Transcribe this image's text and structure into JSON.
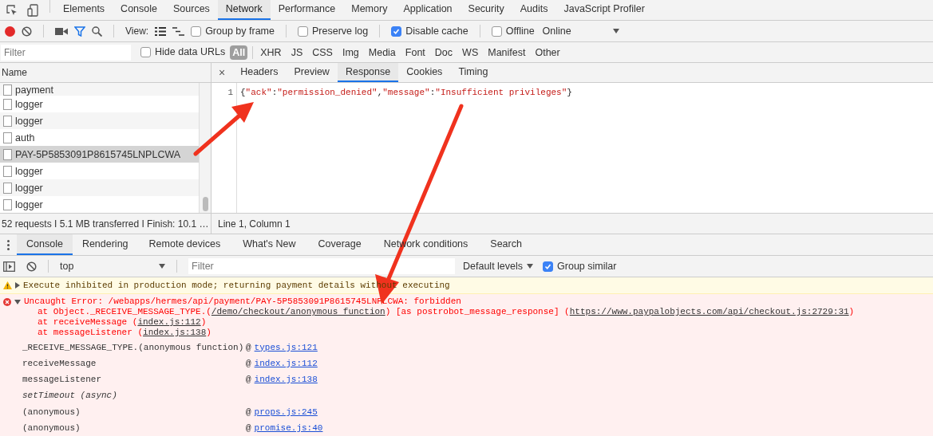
{
  "main_tabs": [
    {
      "label": "Elements",
      "selected": false
    },
    {
      "label": "Console",
      "selected": false
    },
    {
      "label": "Sources",
      "selected": false
    },
    {
      "label": "Network",
      "selected": true
    },
    {
      "label": "Performance",
      "selected": false
    },
    {
      "label": "Memory",
      "selected": false
    },
    {
      "label": "Application",
      "selected": false
    },
    {
      "label": "Security",
      "selected": false
    },
    {
      "label": "Audits",
      "selected": false
    },
    {
      "label": "JavaScript Profiler",
      "selected": false
    }
  ],
  "network_toolbar": {
    "recording": true,
    "view_label": "View:",
    "checkboxes": [
      {
        "label": "Group by frame",
        "checked": false
      },
      {
        "label": "Preserve log",
        "checked": false
      },
      {
        "label": "Disable cache",
        "checked": true
      },
      {
        "label": "Offline",
        "checked": false
      }
    ],
    "throttling": "Online"
  },
  "filter_bar": {
    "placeholder": "Filter",
    "hide_data_urls": {
      "label": "Hide data URLs",
      "checked": false
    },
    "types": [
      {
        "label": "All",
        "selected": true
      },
      {
        "label": "XHR",
        "selected": false
      },
      {
        "label": "JS",
        "selected": false
      },
      {
        "label": "CSS",
        "selected": false
      },
      {
        "label": "Img",
        "selected": false
      },
      {
        "label": "Media",
        "selected": false
      },
      {
        "label": "Font",
        "selected": false
      },
      {
        "label": "Doc",
        "selected": false
      },
      {
        "label": "WS",
        "selected": false
      },
      {
        "label": "Manifest",
        "selected": false
      },
      {
        "label": "Other",
        "selected": false
      }
    ]
  },
  "requests": {
    "column": "Name",
    "rows": [
      {
        "name": "payment",
        "selected": false
      },
      {
        "name": "logger",
        "selected": false
      },
      {
        "name": "logger",
        "selected": false
      },
      {
        "name": "auth",
        "selected": false
      },
      {
        "name": "PAY-5P5853091P8615745LNPLCWA",
        "selected": true
      },
      {
        "name": "logger",
        "selected": false
      },
      {
        "name": "logger",
        "selected": false
      },
      {
        "name": "logger",
        "selected": false
      }
    ],
    "summary": "52 requests I 5.1 MB transferred I Finish: 10.1 …"
  },
  "detail": {
    "close": "×",
    "tabs": [
      {
        "label": "Headers",
        "selected": false
      },
      {
        "label": "Preview",
        "selected": false
      },
      {
        "label": "Response",
        "selected": true
      },
      {
        "label": "Cookies",
        "selected": false
      },
      {
        "label": "Timing",
        "selected": false
      }
    ],
    "line_number": "1",
    "response": [
      {
        "kind": "punct",
        "text": "{"
      },
      {
        "kind": "string",
        "text": "\"ack\""
      },
      {
        "kind": "punct",
        "text": ":"
      },
      {
        "kind": "string",
        "text": "\"permission_denied\""
      },
      {
        "kind": "punct",
        "text": ","
      },
      {
        "kind": "string",
        "text": "\"message\""
      },
      {
        "kind": "punct",
        "text": ":"
      },
      {
        "kind": "string",
        "text": "\"Insufficient privileges\""
      },
      {
        "kind": "punct",
        "text": "}"
      }
    ],
    "position": "Line 1, Column 1"
  },
  "drawer_tabs": [
    {
      "label": "Console",
      "selected": true
    },
    {
      "label": "Rendering",
      "selected": false
    },
    {
      "label": "Remote devices",
      "selected": false
    },
    {
      "label": "What's New",
      "selected": false
    },
    {
      "label": "Coverage",
      "selected": false
    },
    {
      "label": "Network conditions",
      "selected": false
    },
    {
      "label": "Search",
      "selected": false
    }
  ],
  "console_toolbar": {
    "context": "top",
    "placeholder": "Filter",
    "levels": "Default levels",
    "group_similar": {
      "label": "Group similar",
      "checked": true
    }
  },
  "messages": [
    {
      "kind": "warning",
      "text": "Execute inhibited in production mode; returning payment details without executing"
    },
    {
      "kind": "error",
      "text": "Uncaught Error: /webapps/hermes/api/payment/PAY-5P5853091P8615745LNPLCWA: forbidden",
      "stack": [
        [
          {
            "text": "at Object._RECEIVE_MESSAGE_TYPE.(",
            "link": false
          },
          {
            "text": "/demo/checkout/anonymous function",
            "link": true
          },
          {
            "text": ") [as postrobot_message_response] (",
            "link": false
          },
          {
            "text": "https://www.paypalobjects.com/api/checkout.js:2729:31",
            "link": true
          },
          {
            "text": ")",
            "link": false
          }
        ],
        [
          {
            "text": "at receiveMessage (",
            "link": false
          },
          {
            "text": "index.js:112",
            "link": true
          },
          {
            "text": ")",
            "link": false
          }
        ],
        [
          {
            "text": "at messageListener (",
            "link": false
          },
          {
            "text": "index.js:138",
            "link": true
          },
          {
            "text": ")",
            "link": false
          }
        ]
      ],
      "frames": [
        {
          "kind": "frame",
          "function": "_RECEIVE_MESSAGE_TYPE.(anonymous function)",
          "prefix": "@",
          "location": "types.js:121"
        },
        {
          "kind": "frame",
          "function": "receiveMessage",
          "prefix": "@",
          "location": "index.js:112"
        },
        {
          "kind": "frame",
          "function": "messageListener",
          "prefix": "@",
          "location": "index.js:138"
        },
        {
          "kind": "async",
          "function": "setTimeout (async)"
        },
        {
          "kind": "frame",
          "function": "(anonymous)",
          "prefix": "@",
          "location": "props.js:245"
        },
        {
          "kind": "frame",
          "function": "(anonymous)",
          "prefix": "@",
          "location": "promise.js:40"
        }
      ]
    }
  ],
  "annotations": [
    {
      "kind": "arrow"
    },
    {
      "kind": "arrow"
    }
  ]
}
